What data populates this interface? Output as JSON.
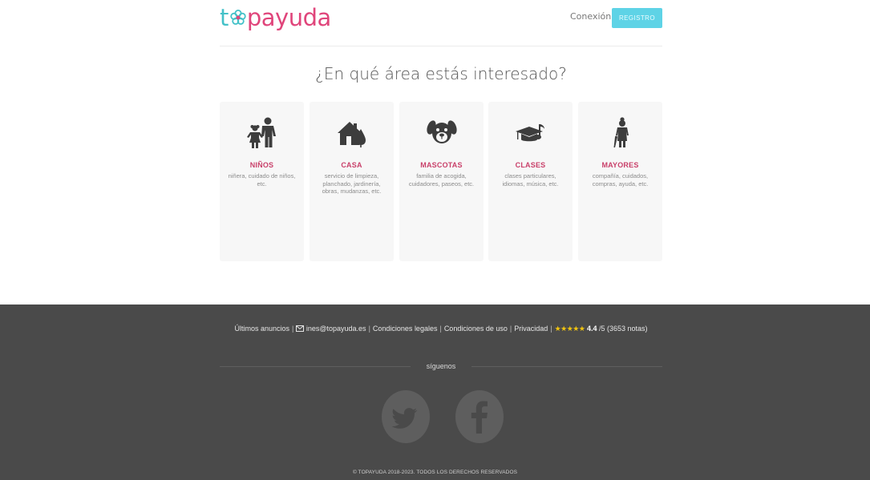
{
  "header": {
    "logo": {
      "part1": "t",
      "part2": "payuda"
    },
    "login_label": "Conexión",
    "register_label": "REGISTRO"
  },
  "main": {
    "heading": "¿En qué área estás interesado?",
    "categories": [
      {
        "title": "NIÑOS",
        "description": "niñera, cuidado de niños, etc.",
        "icon": "children-icon"
      },
      {
        "title": "CASA",
        "description": "servicio de limpieza, planchado, jardinería, obras, mudanzas, etc.",
        "icon": "house-icon"
      },
      {
        "title": "MASCOTAS",
        "description": "familia de acogida, cuidadores, paseos, etc.",
        "icon": "dog-icon"
      },
      {
        "title": "CLASES",
        "description": "clases particulares, idiomas, música, etc.",
        "icon": "graduation-music-icon"
      },
      {
        "title": "MAYORES",
        "description": "compañía, cuidados, compras, ayuda, etc.",
        "icon": "elderly-icon"
      }
    ]
  },
  "footer": {
    "links": {
      "latest_ads": "Últimos anuncios",
      "email": "ines@topayuda.es",
      "legal": "Condiciones legales",
      "terms": "Condiciones de uso",
      "privacy": "Privacidad"
    },
    "rating": {
      "stars": "★★★★★",
      "value": "4.4",
      "scale": " /5 (3653 notas)"
    },
    "follow_label": "síguenos",
    "social": [
      "twitter-icon",
      "facebook-icon"
    ],
    "copyright": "© TOPAYUDA 2018-2023. TODOS LOS DERECHOS RESERVADOS"
  },
  "colors": {
    "brand_pink": "#e0457b",
    "brand_teal": "#43c1c8",
    "register_button": "#5ed3e6",
    "category_title": "#c9406a",
    "footer_bg": "#4a4a4a",
    "star": "#f1c40f"
  }
}
